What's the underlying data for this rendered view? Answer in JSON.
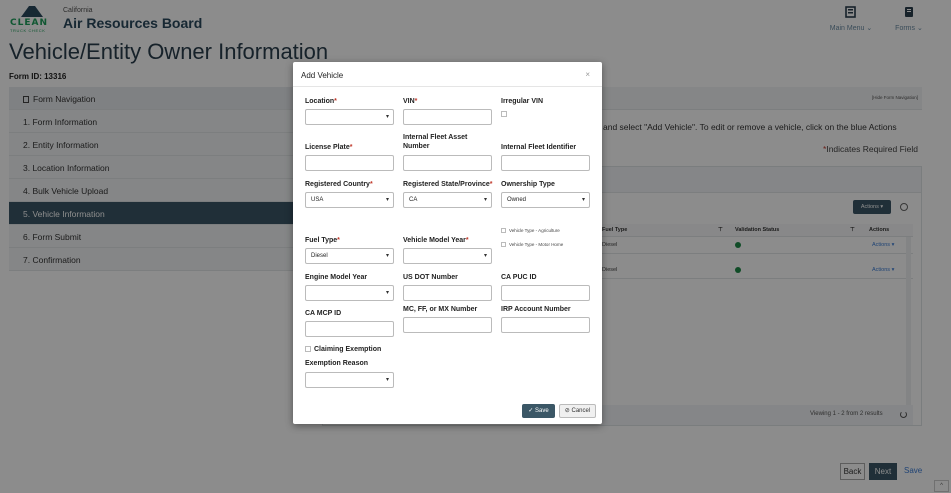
{
  "header": {
    "state": "California",
    "logo_text": "CLEAN",
    "logo_sub": "TRUCK CHECK",
    "board": "Air Resources Board",
    "main_menu": "Main Menu ⌄",
    "forms": "Forms ⌄"
  },
  "page": {
    "title": "Vehicle/Entity Owner Information",
    "form_id": "Form ID: 13316"
  },
  "sidebar": {
    "items": [
      {
        "label": "Form Navigation"
      },
      {
        "label": "1. Form Information"
      },
      {
        "label": "2. Entity Information"
      },
      {
        "label": "3. Location Information"
      },
      {
        "label": "4. Bulk Vehicle Upload"
      },
      {
        "label": "5. Vehicle Information"
      },
      {
        "label": "6. Form Submit"
      },
      {
        "label": "7. Confirmation"
      }
    ]
  },
  "panel": {
    "hide_nav": "[Hide Form Navigation]",
    "instruction": "and select \"Add Vehicle\". To edit or remove a vehicle, click on the blue Actions",
    "required_note": "Indicates Required Field",
    "actions_label": "Actions ▾",
    "table": {
      "headers": [
        "Fuel Type",
        "Validation Status",
        "Actions"
      ],
      "rows": [
        {
          "fuel": "Diesel",
          "actions": "Actions ▾"
        },
        {
          "fuel": "Diesel",
          "actions": "Actions ▾"
        }
      ]
    },
    "viewing": "Viewing 1 - 2 from 2 results"
  },
  "bottom": {
    "back": "Back",
    "next": "Next",
    "save": "Save"
  },
  "modal": {
    "title": "Add Vehicle",
    "close": "×",
    "fields": {
      "location": {
        "label": "Location",
        "value": ""
      },
      "vin": {
        "label": "VIN",
        "value": ""
      },
      "irregular_vin": {
        "label": "Irregular VIN"
      },
      "license_plate": {
        "label": "License Plate",
        "value": ""
      },
      "internal_fleet_asset": {
        "label": "Internal Fleet Asset Number",
        "value": ""
      },
      "internal_fleet_identifier": {
        "label": "Internal Fleet Identifier",
        "value": ""
      },
      "registered_country": {
        "label": "Registered Country",
        "value": "USA"
      },
      "registered_state": {
        "label": "Registered State/Province",
        "value": "CA"
      },
      "ownership_type": {
        "label": "Ownership Type",
        "value": "Owned"
      },
      "fuel_type": {
        "label": "Fuel Type",
        "value": "Diesel"
      },
      "vehicle_model_year": {
        "label": "Vehicle Model Year",
        "value": ""
      },
      "type_agriculture": {
        "label": "Vehicle Type - Agriculture"
      },
      "type_motor_home": {
        "label": "Vehicle Type - Motor Home"
      },
      "engine_model_year": {
        "label": "Engine Model Year",
        "value": ""
      },
      "us_dot": {
        "label": "US DOT Number",
        "value": ""
      },
      "ca_puc": {
        "label": "CA PUC ID",
        "value": ""
      },
      "ca_mcp": {
        "label": "CA MCP ID",
        "value": ""
      },
      "mc_ff_mx": {
        "label": "MC, FF, or MX Number",
        "value": ""
      },
      "irp": {
        "label": "IRP Account Number",
        "value": ""
      },
      "claiming_exemption": {
        "label": "Claiming Exemption"
      },
      "exemption_reason": {
        "label": "Exemption Reason",
        "value": ""
      }
    },
    "save": "Save",
    "cancel": "Cancel"
  }
}
